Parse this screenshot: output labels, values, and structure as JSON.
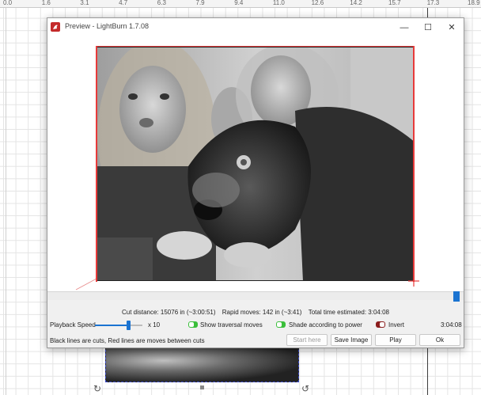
{
  "ruler": {
    "ticks": [
      "0.0",
      "1.6",
      "3.1",
      "4.7",
      "6.3",
      "7.9",
      "9.4",
      "11.0",
      "12.6",
      "14.2",
      "15.7",
      "17.3",
      "18.9"
    ]
  },
  "window": {
    "title": "Preview - LightBurn 1.7.08",
    "minimize_icon": "minimize-icon",
    "maximize_icon": "maximize-icon",
    "close_icon": "close-icon"
  },
  "stats": {
    "cut_distance": "Cut distance: 15076 in (~3:00:51)",
    "rapid_moves": "Rapid moves: 142 in (~3:41)",
    "total_time": "Total time estimated: 3:04:08"
  },
  "controls": {
    "playback_speed_label": "Playback Speed",
    "playback_speed_value": 0.7,
    "speed_multiplier": "x 10",
    "show_traversal_label": "Show traversal moves",
    "show_traversal_on": true,
    "shade_label": "Shade according to power",
    "shade_on": true,
    "invert_label": "Invert",
    "invert_on": false,
    "elapsed_time": "3:04:08"
  },
  "footer": {
    "hint": "Black lines are cuts, Red lines are moves between cuts",
    "start_here": "Start here",
    "save_image": "Save Image",
    "play": "Play",
    "ok": "Ok"
  },
  "playback_progress": 0.99,
  "colors": {
    "accent": "#1a73d1",
    "toggle_on": "#3bbf3b",
    "toggle_off": "#8a1c1c",
    "rapid_line": "#e83a3a"
  }
}
